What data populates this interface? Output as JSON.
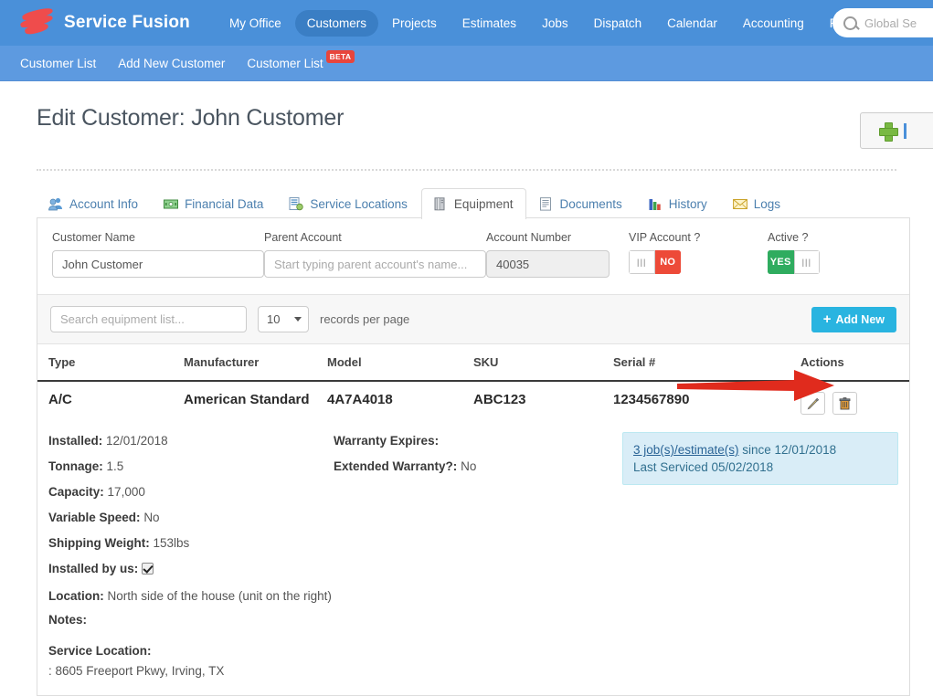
{
  "header": {
    "brand": "Service Fusion",
    "nav": [
      {
        "label": "My Office",
        "active": false
      },
      {
        "label": "Customers",
        "active": true
      },
      {
        "label": "Projects",
        "active": false
      },
      {
        "label": "Estimates",
        "active": false
      },
      {
        "label": "Jobs",
        "active": false
      },
      {
        "label": "Dispatch",
        "active": false
      },
      {
        "label": "Calendar",
        "active": false
      },
      {
        "label": "Accounting",
        "active": false
      },
      {
        "label": "Reports",
        "active": false
      }
    ],
    "search_placeholder": "Global Se",
    "brand_color": "#4a90d9"
  },
  "subnav": {
    "items": [
      {
        "label": "Customer List",
        "badge": ""
      },
      {
        "label": "Add New Customer",
        "badge": ""
      },
      {
        "label": "Customer List",
        "badge": "BETA"
      }
    ]
  },
  "page": {
    "title": "Edit Customer: John Customer"
  },
  "tabs": [
    {
      "label": "Account Info",
      "icon": "users-icon",
      "active": false
    },
    {
      "label": "Financial Data",
      "icon": "money-icon",
      "active": false
    },
    {
      "label": "Service Locations",
      "icon": "document-list-icon",
      "active": false
    },
    {
      "label": "Equipment",
      "icon": "server-icon",
      "active": true
    },
    {
      "label": "Documents",
      "icon": "page-icon",
      "active": false
    },
    {
      "label": "History",
      "icon": "bar-chart-icon",
      "active": false
    },
    {
      "label": "Logs",
      "icon": "envelope-icon",
      "active": false
    }
  ],
  "form": {
    "customer_name": {
      "label": "Customer Name",
      "value": "John Customer"
    },
    "parent_account": {
      "label": "Parent Account",
      "value": "",
      "placeholder": "Start typing parent account's name..."
    },
    "account_number": {
      "label": "Account Number",
      "value": "40035"
    },
    "vip_account": {
      "label": "VIP Account ?",
      "value": "NO",
      "color": "#ed4a38"
    },
    "active": {
      "label": "Active ?",
      "value": "YES",
      "color": "#2fac5f"
    }
  },
  "list_bar": {
    "search_placeholder": "Search equipment list...",
    "per_page_value": "10",
    "per_page_label": "records per page",
    "add_new_label": "Add New"
  },
  "table": {
    "columns": [
      "Type",
      "Manufacturer",
      "Model",
      "SKU",
      "Serial #",
      "Actions"
    ],
    "rows": [
      {
        "type": "A/C",
        "manufacturer": "American Standard",
        "model": "4A7A4018",
        "sku": "ABC123",
        "serial": "1234567890"
      }
    ]
  },
  "detail": {
    "installed": {
      "label": "Installed:",
      "value": "12/01/2018"
    },
    "tonnage": {
      "label": "Tonnage:",
      "value": "1.5"
    },
    "capacity": {
      "label": "Capacity:",
      "value": "17,000"
    },
    "variable_speed": {
      "label": "Variable Speed:",
      "value": "No"
    },
    "shipping_weight": {
      "label": "Shipping Weight:",
      "value": "153lbs"
    },
    "installed_by_us": {
      "label": "Installed by us:",
      "checked": true
    },
    "location": {
      "label": "Location:",
      "value": "North side of the house (unit on the right)"
    },
    "notes": {
      "label": "Notes:",
      "value": ""
    },
    "service_location": {
      "label": "Service Location:",
      "value": ": 8605 Freeport Pkwy, Irving, TX"
    },
    "warranty_expires": {
      "label": "Warranty Expires:",
      "value": ""
    },
    "extended_warranty": {
      "label": "Extended Warranty?:",
      "value": "No"
    },
    "info_box": {
      "link": "3 job(s)/estimate(s)",
      "since": " since 12/01/2018",
      "last_serviced": "Last Serviced 05/02/2018"
    }
  }
}
